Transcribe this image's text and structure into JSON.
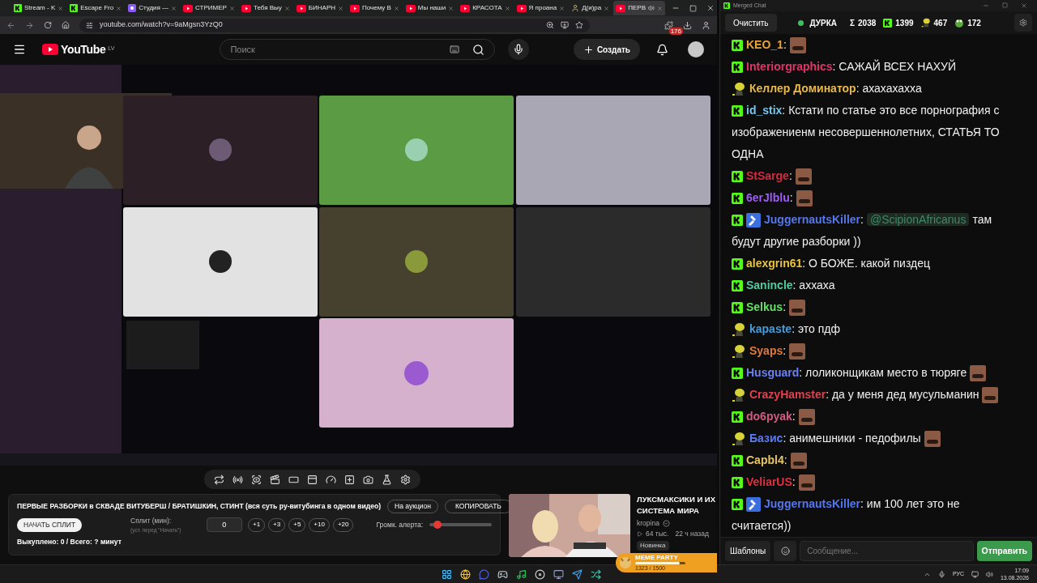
{
  "browser": {
    "tabs": [
      {
        "label": "Stream - K",
        "kind": "kick",
        "selected": false,
        "audio": false
      },
      {
        "label": "Escape Fro",
        "kind": "kick",
        "selected": false,
        "audio": false
      },
      {
        "label": "Студия —",
        "kind": "studio",
        "selected": false,
        "audio": false
      },
      {
        "label": "СТРИМЕР",
        "kind": "video",
        "selected": false,
        "audio": false
      },
      {
        "label": "Тебя Выу",
        "kind": "video",
        "selected": false,
        "audio": false
      },
      {
        "label": "БИНАРН",
        "kind": "video",
        "selected": false,
        "audio": false
      },
      {
        "label": "Почему В",
        "kind": "video",
        "selected": false,
        "audio": false
      },
      {
        "label": "Мы наши",
        "kind": "video",
        "selected": false,
        "audio": false
      },
      {
        "label": "КРАСОТА",
        "kind": "video",
        "selected": false,
        "audio": false
      },
      {
        "label": "Я проана",
        "kind": "video",
        "selected": false,
        "audio": false
      },
      {
        "label": "Д(и)ра",
        "kind": "person",
        "selected": false,
        "audio": false
      },
      {
        "label": "ПЕРВ",
        "kind": "video",
        "selected": true,
        "audio": true
      }
    ],
    "address": "youtube.com/watch?v=9aMgsn3YzQ0",
    "extension_badge": "176"
  },
  "youtube": {
    "logo": "YouTube",
    "region": "LV",
    "search": {
      "placeholder": "Поиск"
    },
    "create": "Создать"
  },
  "panel": {
    "title": "ПЕРВЫЕ РАЗБОРКИ в СКВАДЕ ВИТУБЕРШ / БРАТИШКИН, СТИНТ (вся суть ру-витубинга в одном видео)",
    "auction": "На аукцион",
    "copy": "КОПИРОВАТЬ",
    "start": "НАЧАТЬ СПЛИТ",
    "split_label": "Сплит (мин):",
    "split_hint": "(уст. перед \"Начать\")",
    "split_value": "0",
    "steps": [
      "+1",
      "+3",
      "+5",
      "+10",
      "+20"
    ],
    "volume_label": "Громк. алерта:",
    "volume": {
      "level": 0.13
    },
    "bought": "Выкуплено: 0 / Всего: ? минут"
  },
  "recommended": {
    "title": "ЛУКСМАКСИКИ И ИХ СИСТЕМА МИРА",
    "channel": "kropina",
    "views": "64 тыс.",
    "age": "22 ч назад",
    "badge": "Новинка"
  },
  "overlay": {
    "title": "MEME PARTY",
    "progress": {
      "label": "1323 / 1500",
      "level": 0.88
    }
  },
  "chat": {
    "window_title": "Merged Chat",
    "clear": "Очистить",
    "status": {
      "label": "ДУРКА",
      "color": "#3fbf5f"
    },
    "stats": [
      {
        "kind": "sigma",
        "symbol": "Σ",
        "value": "2038"
      },
      {
        "kind": "kick",
        "value": "1399"
      },
      {
        "kind": "figure",
        "value": "467"
      },
      {
        "kind": "frog",
        "value": "172"
      }
    ],
    "messages": [
      {
        "kind": "kick",
        "moderator": false,
        "user": "KEO_1",
        "color": "#e8a33a",
        "parts": [
          {
            "kind": "text",
            "text": ":"
          },
          {
            "kind": "emote"
          }
        ]
      },
      {
        "kind": "kick",
        "moderator": false,
        "user": "Interiorgraphics",
        "color": "#e0356a",
        "parts": [
          {
            "kind": "text",
            "text": ": САЖАЙ ВСЕХ НАХУЙ"
          }
        ]
      },
      {
        "kind": "figure",
        "moderator": false,
        "user": "Келлер Доминатор",
        "color": "#e8b94a",
        "parts": [
          {
            "kind": "text",
            "text": ": ахахахахха"
          }
        ]
      },
      {
        "kind": "kick",
        "moderator": false,
        "user": "id_stix",
        "color": "#74c7ee",
        "parts": [
          {
            "kind": "text",
            "text": ": Кстати по статье это все порнография с"
          },
          {
            "kind": "continuation",
            "text": "изображениенм несовершеннолетних, СТАТЬЯ ТО ОДНА"
          }
        ]
      },
      {
        "kind": "kick",
        "moderator": false,
        "user": "StSarge",
        "color": "#d42a40",
        "parts": [
          {
            "kind": "text",
            "text": ":"
          },
          {
            "kind": "emote"
          }
        ]
      },
      {
        "kind": "kick",
        "moderator": false,
        "user": "6erJlblu",
        "color": "#9d5cf2",
        "parts": [
          {
            "kind": "text",
            "text": ":"
          },
          {
            "kind": "emote"
          }
        ]
      },
      {
        "kind": "kick",
        "moderator": true,
        "user": "JuggernautsKiller",
        "color": "#5577ee",
        "parts": [
          {
            "kind": "text",
            "text": ":"
          },
          {
            "kind": "mention",
            "text": "@ScipionAfricanus"
          },
          {
            "kind": "text",
            "text": "там"
          },
          {
            "kind": "continuation",
            "text": "будут другие разборки ))"
          }
        ]
      },
      {
        "kind": "kick",
        "moderator": false,
        "user": "alexgrin61",
        "color": "#e9c23f",
        "parts": [
          {
            "kind": "text",
            "text": ": О БОЖЕ. какой пиздец"
          }
        ]
      },
      {
        "kind": "kick",
        "moderator": false,
        "user": "Sanincle",
        "color": "#52c9a3",
        "parts": [
          {
            "kind": "text",
            "text": ": аххаха"
          }
        ]
      },
      {
        "kind": "kick",
        "moderator": false,
        "user": "Selkus",
        "color": "#62e262",
        "parts": [
          {
            "kind": "text",
            "text": ":"
          },
          {
            "kind": "emote"
          }
        ]
      },
      {
        "kind": "figure",
        "moderator": false,
        "user": "kapaste",
        "color": "#4a9ad8",
        "parts": [
          {
            "kind": "text",
            "text": ": это пдф"
          }
        ]
      },
      {
        "kind": "figure",
        "moderator": false,
        "user": "Syaps",
        "color": "#e07a3a",
        "parts": [
          {
            "kind": "text",
            "text": ":"
          },
          {
            "kind": "emote"
          }
        ]
      },
      {
        "kind": "kick",
        "moderator": false,
        "user": "Husguard",
        "color": "#6b80f2",
        "parts": [
          {
            "kind": "text",
            "text": ": лоликонщикам место в тюряге"
          },
          {
            "kind": "emote"
          }
        ]
      },
      {
        "kind": "figure",
        "moderator": false,
        "user": "CrazyHamster",
        "color": "#e3404f",
        "parts": [
          {
            "kind": "text",
            "text": ": да у меня дед мусульманин"
          },
          {
            "kind": "emote"
          }
        ]
      },
      {
        "kind": "kick",
        "moderator": false,
        "user": "do6pyak",
        "color": "#d45a82",
        "parts": [
          {
            "kind": "text",
            "text": ":"
          },
          {
            "kind": "emote"
          }
        ]
      },
      {
        "kind": "figure",
        "moderator": false,
        "user": "Базис",
        "color": "#5a7bf2",
        "parts": [
          {
            "kind": "text",
            "text": ": анимешники - педофилы"
          },
          {
            "kind": "emote"
          }
        ]
      },
      {
        "kind": "kick",
        "moderator": false,
        "user": "Capbl4",
        "color": "#e8c462",
        "parts": [
          {
            "kind": "text",
            "text": ":"
          },
          {
            "kind": "emote"
          }
        ]
      },
      {
        "kind": "kick",
        "moderator": false,
        "user": "VeliarUS",
        "color": "#e0303f",
        "parts": [
          {
            "kind": "text",
            "text": ":"
          },
          {
            "kind": "emote"
          }
        ]
      },
      {
        "kind": "kick",
        "moderator": true,
        "user": "JuggernautsKiller",
        "color": "#5577ee",
        "parts": [
          {
            "kind": "text",
            "text": ": им 100 лет это не"
          },
          {
            "kind": "continuation",
            "text": "считается))"
          }
        ]
      }
    ],
    "templates": "Шаблоны",
    "input": {
      "placeholder": "Сообщение..."
    },
    "send": "Отправить"
  },
  "taskbar": {
    "language": "РУС",
    "time": "17:09",
    "date": "13.08.2026"
  }
}
